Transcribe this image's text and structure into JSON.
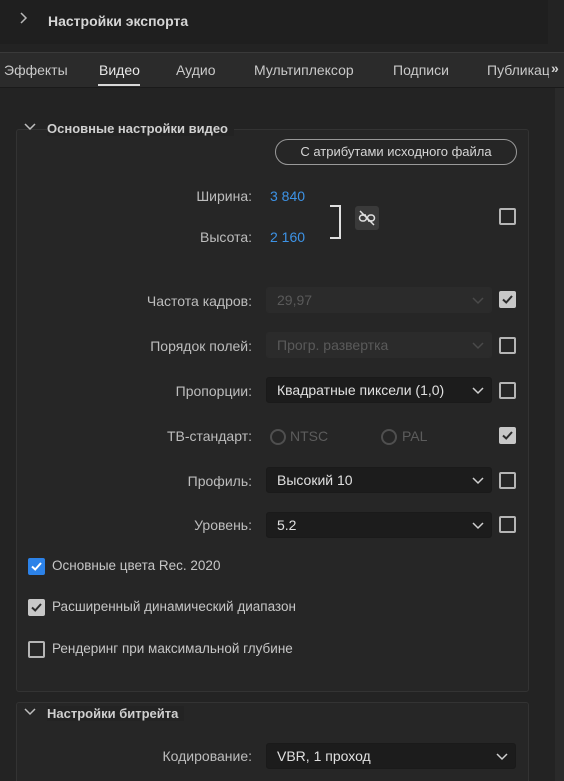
{
  "header": {
    "title": "Настройки экспорта"
  },
  "tabs": [
    {
      "label": "Эффекты"
    },
    {
      "label": "Видео"
    },
    {
      "label": "Аудио"
    },
    {
      "label": "Мультиплексор"
    },
    {
      "label": "Подписи"
    },
    {
      "label": "Публикац"
    }
  ],
  "tabs_more": "»",
  "basic_video": {
    "title": "Основные настройки видео",
    "match_source_button": "С атрибутами исходного файла",
    "width_label": "Ширина:",
    "width_value": "3 840",
    "height_label": "Высота:",
    "height_value": "2 160",
    "frame_rate_label": "Частота кадров:",
    "frame_rate_value": "29,97",
    "field_order_label": "Порядок полей:",
    "field_order_value": "Прогр. развертка",
    "aspect_label": "Пропорции:",
    "aspect_value": "Квадратные пиксели (1,0)",
    "tv_standard_label": "ТВ-стандарт:",
    "tv_ntsc": "NTSC",
    "tv_pal": "PAL",
    "profile_label": "Профиль:",
    "profile_value": "Высокий 10",
    "level_label": "Уровень:",
    "level_value": "5.2",
    "rec2020_label": "Основные цвета Rec. 2020",
    "hdr_label": "Расширенный динамический диапазон",
    "max_depth_label": "Рендеринг при максимальной глубине"
  },
  "checkbox_states": {
    "link_dims": false,
    "frame_rate": true,
    "field_order": false,
    "aspect": false,
    "tv_standard": true,
    "profile": false,
    "level": false,
    "rec2020": true,
    "hdr": true,
    "max_depth": false
  },
  "bitrate": {
    "title": "Настройки битрейта",
    "encoding_label": "Кодирование:",
    "encoding_value": "VBR, 1 проход"
  },
  "colors": {
    "accent_blue": "#2c82e8",
    "value_blue": "#3d93e6",
    "background": "#232323"
  }
}
